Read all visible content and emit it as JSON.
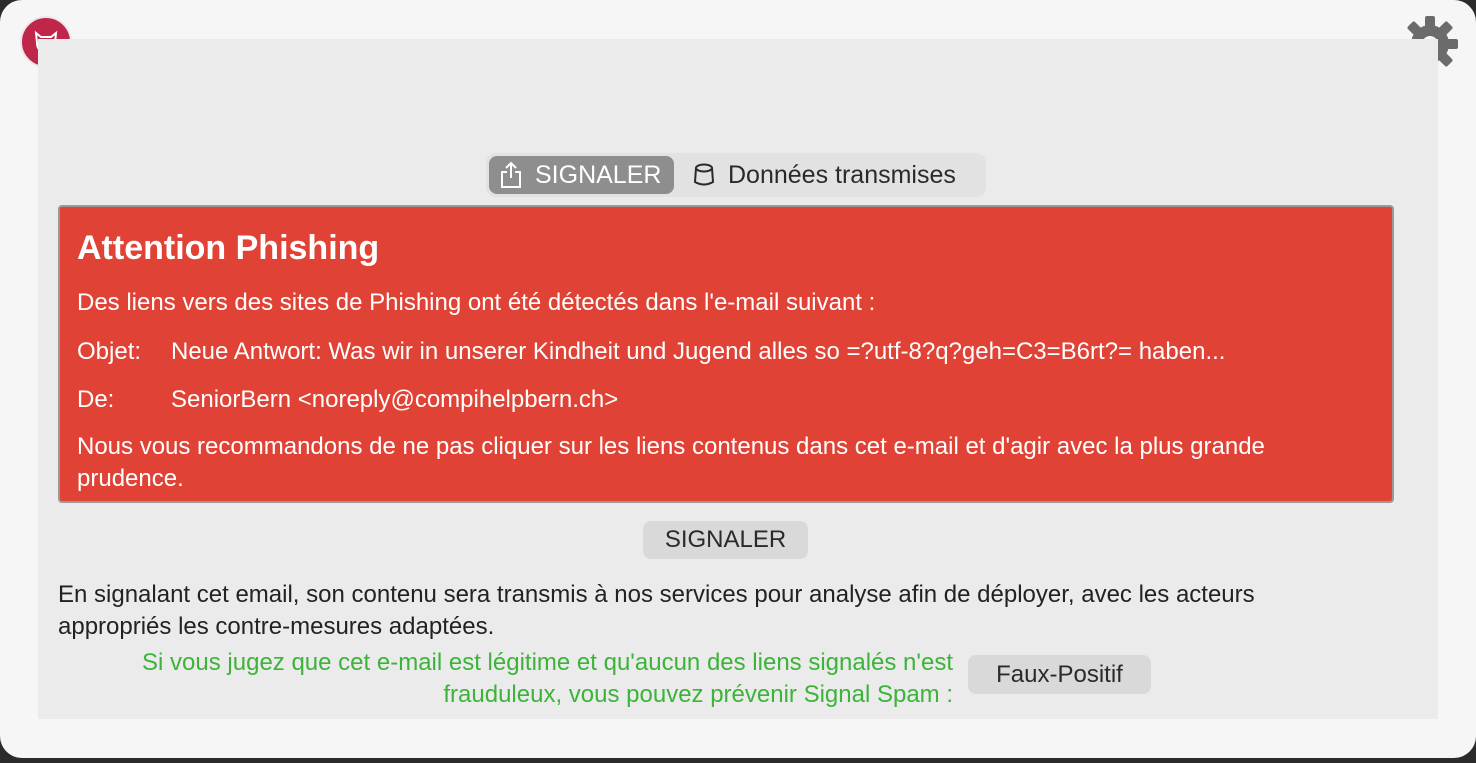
{
  "header": {
    "logo_icon": "signal-spam-logo-icon",
    "settings_icon": "gear-icon"
  },
  "tabs": [
    {
      "label": "SIGNALER",
      "icon": "share-icon",
      "active": true
    },
    {
      "label": "Données transmises",
      "icon": "database-icon",
      "active": false
    }
  ],
  "alert": {
    "title": "Attention Phishing",
    "intro": "Des liens vers des sites de Phishing ont été détectés dans l'e-mail suivant :",
    "subject_label": "Objet:",
    "subject_value": "Neue Antwort: Was wir in unserer Kindheit und Jugend alles so =?utf-8?q?geh=C3=B6rt?= haben...",
    "from_label": "De:",
    "from_value": "SeniorBern <noreply@compihelpbern.ch>",
    "recommendation": "Nous vous recommandons de ne pas cliquer sur les liens contenus dans cet e-mail et d'agir avec la plus grande prudence."
  },
  "report_button_label": "SIGNALER",
  "info_text": "En signalant cet email, son contenu sera transmis à nos services pour analyse afin de déployer, avec les acteurs appropriés les contre-mesures adaptées.",
  "false_positive": {
    "note": "Si vous jugez que cet e-mail est légitime et qu'aucun des liens signalés n'est frauduleux, vous pouvez prévenir Signal Spam :",
    "button_label": "Faux-Positif"
  },
  "colors": {
    "alert_red": "#e04336",
    "note_green": "#3cb339",
    "logo_crimson": "#c0264a"
  }
}
